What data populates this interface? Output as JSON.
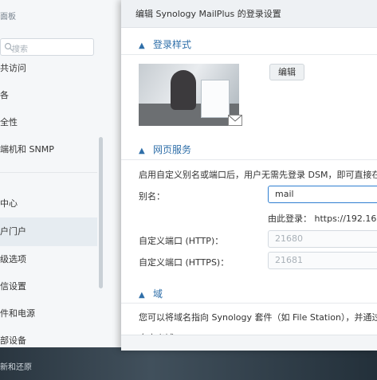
{
  "control_panel": {
    "title": "面板",
    "search_placeholder": "搜索",
    "items": [
      {
        "label": "共访问"
      },
      {
        "label": "各"
      },
      {
        "label": "全性"
      },
      {
        "label": "端机和 SNMP"
      },
      {
        "label": "中心"
      },
      {
        "label": "户门户"
      },
      {
        "label": "级选项"
      },
      {
        "label": "信设置"
      },
      {
        "label": "件和电源"
      },
      {
        "label": "部设备"
      },
      {
        "label": "新和还原"
      }
    ]
  },
  "dialog": {
    "title": "编辑 Synology MailPlus 的登录设置",
    "login_style": {
      "heading": "登录样式",
      "edit_button": "编辑"
    },
    "web_services": {
      "heading": "网页服务",
      "description": "启用自定义别名或端口后，用户无需先登录 DSM，即可直接在新",
      "alias_label": "别名：",
      "alias_value": "mail",
      "login_via": "由此登录：  https://192.16",
      "http_label": "自定义端口 (HTTP)：",
      "http_placeholder": "21680",
      "https_label": "自定义端口 (HTTPS)：",
      "https_placeholder": "21681"
    },
    "domain": {
      "heading": "域",
      "description": "您可以将域名指向 Synology 套件（如 File Station），并通过",
      "custom_domain_label": "自定义域："
    }
  }
}
